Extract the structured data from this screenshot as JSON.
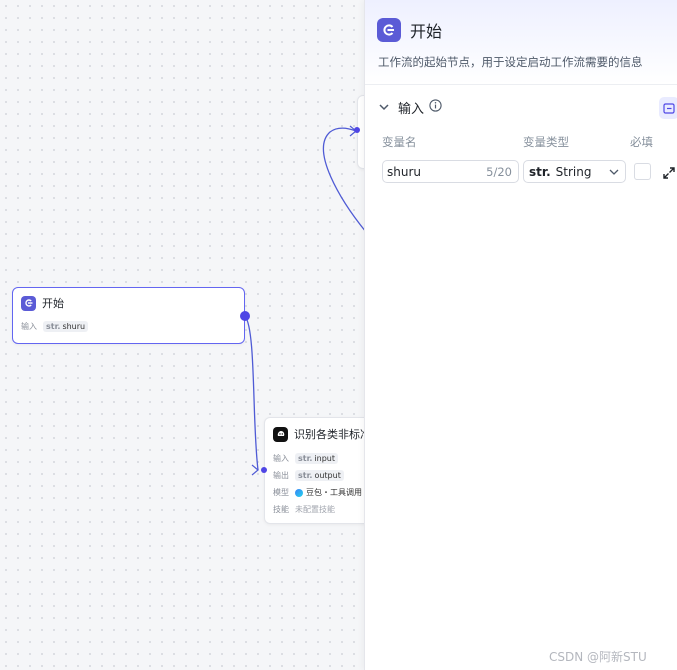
{
  "canvas": {
    "start_node": {
      "title": "开始",
      "input_key": "输入",
      "input_type": "str.",
      "input_name": "shuru"
    },
    "recognize_node": {
      "title": "识别各类非标准",
      "rows": [
        {
          "key": "输入",
          "type": "str.",
          "value": "input"
        },
        {
          "key": "输出",
          "type": "str.",
          "value": "output"
        },
        {
          "key": "模型",
          "value": "豆包・工具调用"
        },
        {
          "key": "技能",
          "value": "未配置技能"
        }
      ]
    }
  },
  "panel": {
    "title": "开始",
    "description": "工作流的起始节点，用于设定启动工作流需要的信息",
    "section_title": "输入",
    "columns": {
      "name": "变量名",
      "type": "变量类型",
      "required": "必填"
    },
    "variable": {
      "name": "shuru",
      "count": "5/20",
      "type_prefix": "str.",
      "type_label": "String"
    }
  },
  "watermark": "CSDN @阿新STU",
  "colors": {
    "accent": "#4f46e5",
    "node_icon": "#5b5bd6"
  }
}
